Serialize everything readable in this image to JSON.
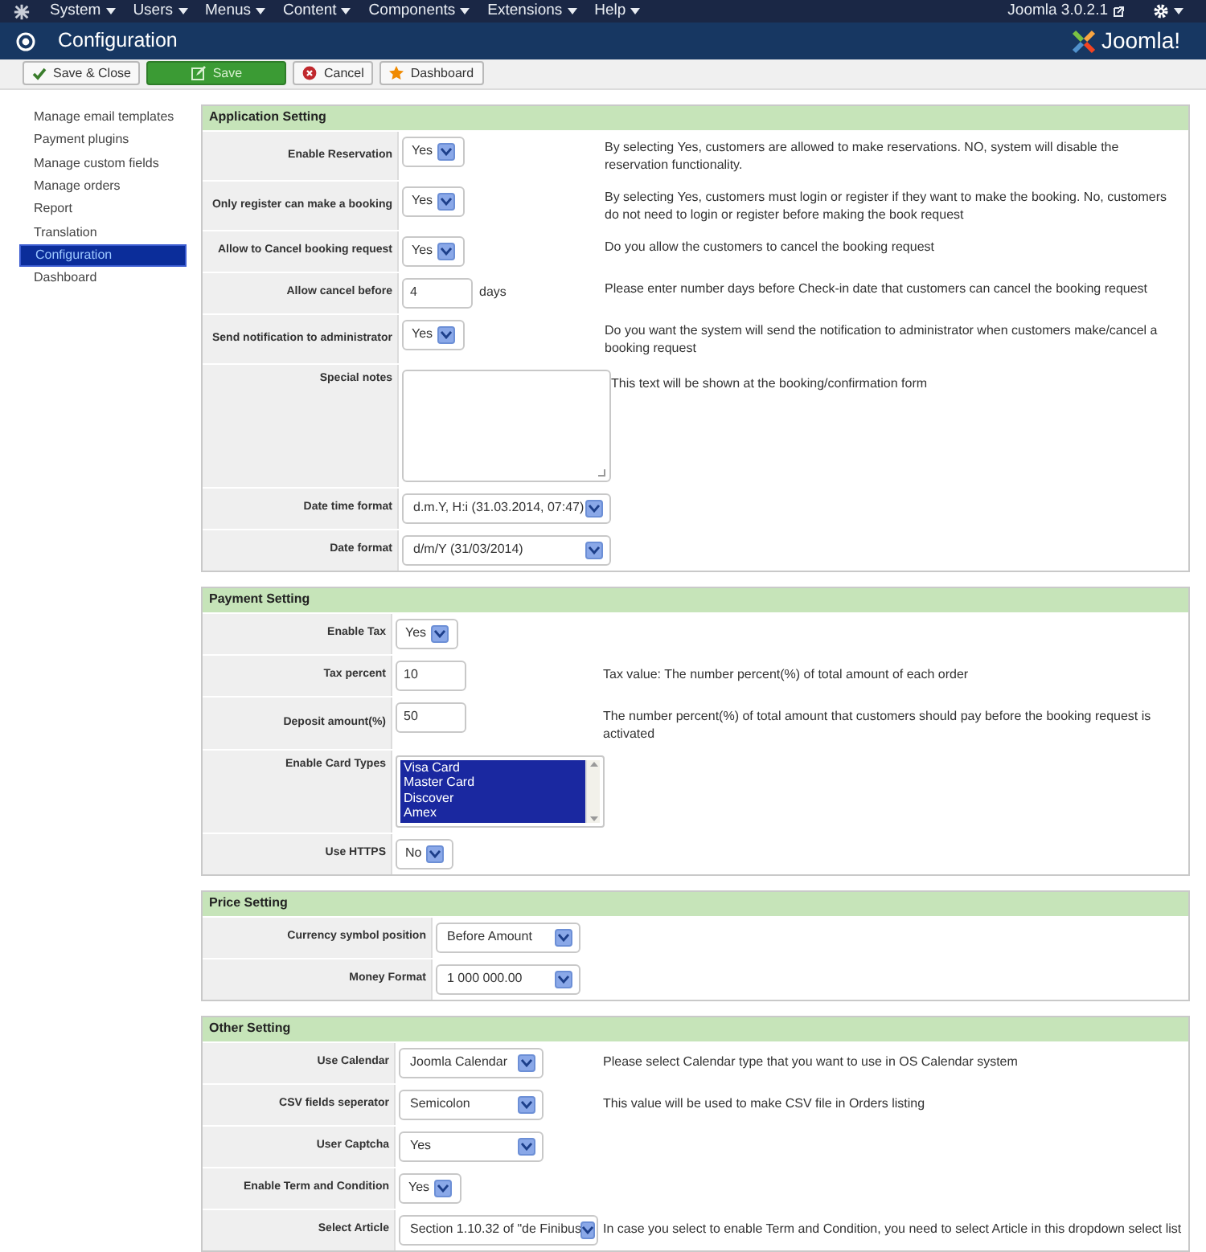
{
  "top_menu": {
    "items": [
      "System",
      "Users",
      "Menus",
      "Content",
      "Components",
      "Extensions",
      "Help"
    ],
    "version": "Joomla 3.0.2.1"
  },
  "header": {
    "title": "Configuration",
    "logo_text": "Joomla!"
  },
  "toolbar": [
    {
      "label": "Save & Close",
      "kind": "default"
    },
    {
      "label": "Save",
      "kind": "primary"
    },
    {
      "label": "Cancel",
      "kind": "default"
    },
    {
      "label": "Dashboard",
      "kind": "default"
    }
  ],
  "sidebar": {
    "items": [
      {
        "label": "Manage email templates",
        "selected": false
      },
      {
        "label": "Payment plugins",
        "selected": false
      },
      {
        "label": "Manage custom fields",
        "selected": false
      },
      {
        "label": "Manage orders",
        "selected": false
      },
      {
        "label": "Report",
        "selected": false
      },
      {
        "label": "Translation",
        "selected": false
      },
      {
        "label": "Configuration",
        "selected": true
      },
      {
        "label": "Dashboard",
        "selected": false
      }
    ]
  },
  "sections": [
    {
      "title": "Application Setting",
      "rows": [
        {
          "label": "Enable Reservation",
          "kind": "select",
          "value": "Yes",
          "description": "By selecting Yes, customers are allowed to make reservations. NO, system will disable the reservation functionality."
        },
        {
          "label": "Only register can make a booking",
          "kind": "select",
          "value": "Yes",
          "description": "By selecting Yes, customers must login or register if they want to make the booking. No, customers do not need to login or register before making the book request"
        },
        {
          "label": "Allow to Cancel booking request",
          "kind": "select",
          "value": "Yes",
          "description": "Do you allow the customers to cancel the booking request"
        },
        {
          "label": "Allow cancel before",
          "kind": "input",
          "value": "4",
          "suffix": "days",
          "description": "Please enter number days before Check-in date that customers can cancel the booking request"
        },
        {
          "label": "Send notification to administrator",
          "kind": "select",
          "value": "Yes",
          "description": "Do you want the system will send the notification to administrator when customers make/cancel a booking request"
        },
        {
          "label": "Special notes",
          "kind": "textarea",
          "description": "This text will be shown at the booking/confirmation form"
        },
        {
          "label": "Date time format",
          "kind": "dropdown",
          "value": "d.m.Y, H:i (31.03.2014, 07:47)"
        },
        {
          "label": "Date format",
          "kind": "dropdown",
          "value": "d/m/Y (31/03/2014)"
        }
      ]
    },
    {
      "title": "Payment Setting",
      "rows": [
        {
          "label": "Enable Tax",
          "kind": "select",
          "value": "Yes"
        },
        {
          "label": "Tax percent",
          "kind": "input",
          "value": "10",
          "description": "Tax value: The number percent(%) of total amount of each order"
        },
        {
          "label": "Deposit amount(%)",
          "kind": "input",
          "value": "50",
          "description": "The number percent(%) of total amount that customers should pay before the booking request is activated"
        },
        {
          "label": "Enable Card Types",
          "kind": "listbox",
          "options": [
            {
              "label": "Visa Card",
              "selected": true
            },
            {
              "label": "Master Card",
              "selected": true
            },
            {
              "label": "Discover",
              "selected": true
            },
            {
              "label": "Amex",
              "selected": true
            }
          ]
        },
        {
          "label": "Use HTTPS",
          "kind": "select",
          "value": "No"
        }
      ]
    },
    {
      "title": "Price Setting",
      "rows": [
        {
          "label": "Currency symbol position",
          "kind": "dropdown",
          "value": "Before Amount"
        },
        {
          "label": "Money Format",
          "kind": "dropdown",
          "value": "1 000 000.00"
        }
      ]
    },
    {
      "title": "Other Setting",
      "rows": [
        {
          "label": "Use Calendar",
          "kind": "dropdown",
          "value": "Joomla Calendar",
          "description": "Please select Calendar type that you want to use in OS Calendar system"
        },
        {
          "label": "CSV fields seperator",
          "kind": "dropdown",
          "value": "Semicolon",
          "description": "This value will be used to make CSV file in Orders listing"
        },
        {
          "label": "User Captcha",
          "kind": "dropdown",
          "value": "Yes"
        },
        {
          "label": "Enable Term and Condition",
          "kind": "select",
          "value": "Yes"
        },
        {
          "label": "Select Article",
          "kind": "dropdown",
          "value": "Section 1.10.32 of \"de Finibus",
          "description": "In case you select to enable Term and Condition, you need to select Article in this dropdown select list"
        }
      ]
    }
  ]
}
